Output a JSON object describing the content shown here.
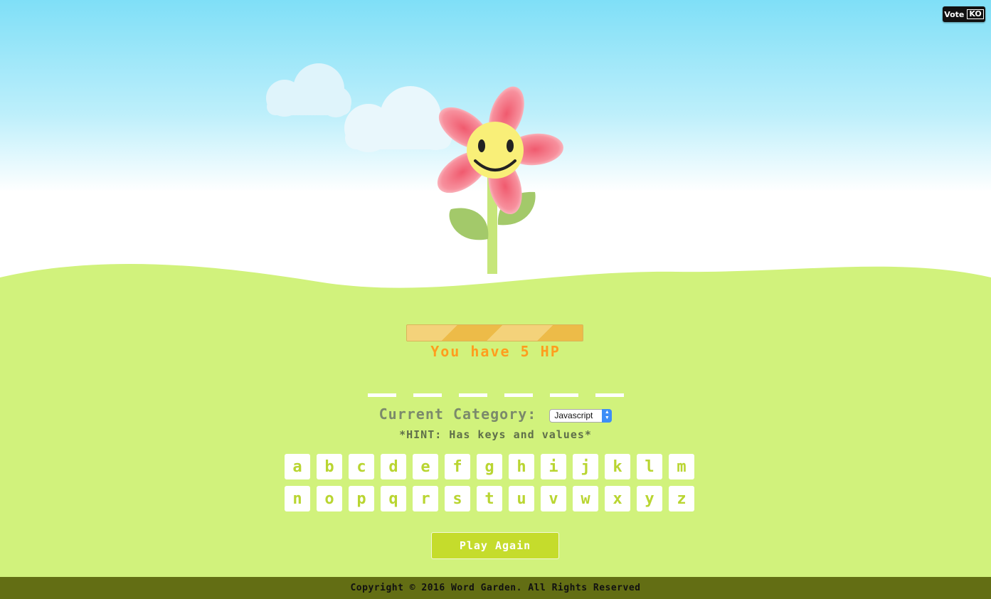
{
  "badge": {
    "vote_label": "Vote",
    "ko_label": "KO"
  },
  "game": {
    "hp_text": "You have 5 HP",
    "hp_value": 5,
    "word_blank_count": 6
  },
  "category": {
    "label": "Current Category:",
    "selected": "Javascript"
  },
  "hint": "*HINT: Has keys and values*",
  "keyboard": {
    "row1": [
      "a",
      "b",
      "c",
      "d",
      "e",
      "f",
      "g",
      "h",
      "i",
      "j",
      "k",
      "l",
      "m"
    ],
    "row2": [
      "n",
      "o",
      "p",
      "q",
      "r",
      "s",
      "t",
      "u",
      "v",
      "w",
      "x",
      "y",
      "z"
    ]
  },
  "play_again_label": "Play Again",
  "footer": "Copyright © 2016 Word Garden. All Rights Reserved",
  "colors": {
    "grass": "#d1f27c",
    "sky": "#7fdff7",
    "key_letter": "#b9d531",
    "hp_text": "#ff9d1e",
    "button": "#c5dc2c",
    "footer_bg": "#636e14"
  }
}
